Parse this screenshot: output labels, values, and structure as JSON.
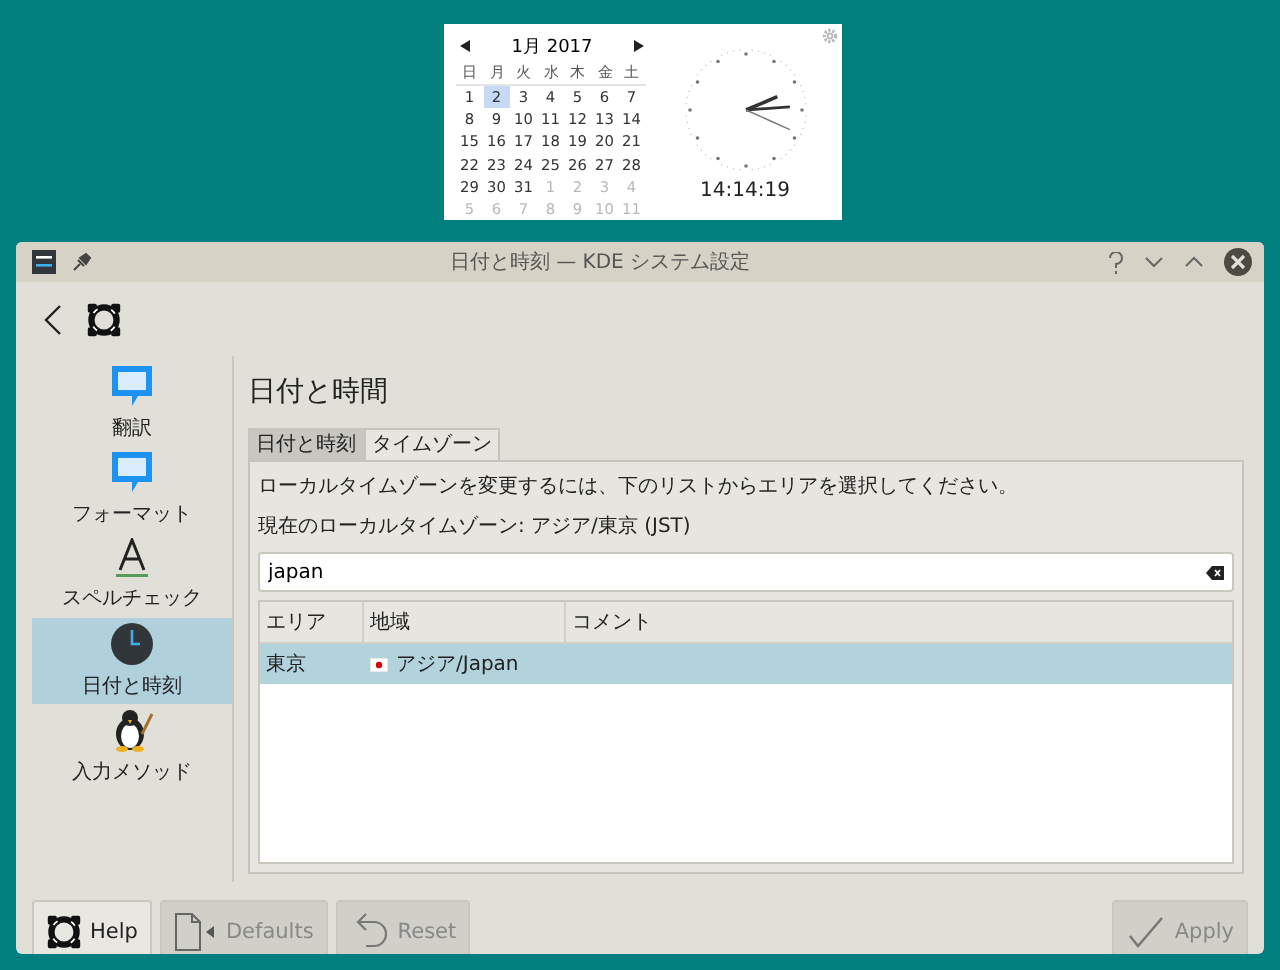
{
  "calendar": {
    "month_label": "1月 2017",
    "weekdays": [
      "日",
      "月",
      "火",
      "水",
      "木",
      "金",
      "土"
    ],
    "weeks": [
      [
        {
          "day": "1",
          "other_month": false,
          "selected": false
        },
        {
          "day": "2",
          "other_month": false,
          "selected": true
        },
        {
          "day": "3",
          "other_month": false,
          "selected": false
        },
        {
          "day": "4",
          "other_month": false,
          "selected": false
        },
        {
          "day": "5",
          "other_month": false,
          "selected": false
        },
        {
          "day": "6",
          "other_month": false,
          "selected": false
        },
        {
          "day": "7",
          "other_month": false,
          "selected": false
        }
      ],
      [
        {
          "day": "8",
          "other_month": false,
          "selected": false
        },
        {
          "day": "9",
          "other_month": false,
          "selected": false
        },
        {
          "day": "10",
          "other_month": false,
          "selected": false
        },
        {
          "day": "11",
          "other_month": false,
          "selected": false
        },
        {
          "day": "12",
          "other_month": false,
          "selected": false
        },
        {
          "day": "13",
          "other_month": false,
          "selected": false
        },
        {
          "day": "14",
          "other_month": false,
          "selected": false
        }
      ],
      [
        {
          "day": "15",
          "other_month": false,
          "selected": false
        },
        {
          "day": "16",
          "other_month": false,
          "selected": false
        },
        {
          "day": "17",
          "other_month": false,
          "selected": false
        },
        {
          "day": "18",
          "other_month": false,
          "selected": false
        },
        {
          "day": "19",
          "other_month": false,
          "selected": false
        },
        {
          "day": "20",
          "other_month": false,
          "selected": false
        },
        {
          "day": "21",
          "other_month": false,
          "selected": false
        }
      ],
      [
        {
          "day": "22",
          "other_month": false,
          "selected": false
        },
        {
          "day": "23",
          "other_month": false,
          "selected": false
        },
        {
          "day": "24",
          "other_month": false,
          "selected": false
        },
        {
          "day": "25",
          "other_month": false,
          "selected": false
        },
        {
          "day": "26",
          "other_month": false,
          "selected": false
        },
        {
          "day": "27",
          "other_month": false,
          "selected": false
        },
        {
          "day": "28",
          "other_month": false,
          "selected": false
        }
      ],
      [
        {
          "day": "29",
          "other_month": false,
          "selected": false
        },
        {
          "day": "30",
          "other_month": false,
          "selected": false
        },
        {
          "day": "31",
          "other_month": false,
          "selected": false
        },
        {
          "day": "1",
          "other_month": true,
          "selected": false
        },
        {
          "day": "2",
          "other_month": true,
          "selected": false
        },
        {
          "day": "3",
          "other_month": true,
          "selected": false
        },
        {
          "day": "4",
          "other_month": true,
          "selected": false
        }
      ],
      [
        {
          "day": "5",
          "other_month": true,
          "selected": false
        },
        {
          "day": "6",
          "other_month": true,
          "selected": false
        },
        {
          "day": "7",
          "other_month": true,
          "selected": false
        },
        {
          "day": "8",
          "other_month": true,
          "selected": false
        },
        {
          "day": "9",
          "other_month": true,
          "selected": false
        },
        {
          "day": "10",
          "other_month": true,
          "selected": false
        },
        {
          "day": "11",
          "other_month": true,
          "selected": false
        }
      ]
    ]
  },
  "clock": {
    "time": "14:14:19"
  },
  "window": {
    "title": "日付と時刻  — KDE システム設定"
  },
  "sidebar": {
    "items": [
      {
        "label": "翻訳",
        "kind": "bubble",
        "selected": false
      },
      {
        "label": "フォーマット",
        "kind": "bubble",
        "selected": false
      },
      {
        "label": "スペルチェック",
        "kind": "letter",
        "selected": false
      },
      {
        "label": "日付と時刻",
        "kind": "clock",
        "selected": true
      },
      {
        "label": "入力メソッド",
        "kind": "penguin",
        "selected": false
      }
    ]
  },
  "page_title": "日付と時間",
  "tabs": [
    {
      "label": "日付と時刻",
      "selected": false
    },
    {
      "label": "タイムゾーン",
      "selected": true
    }
  ],
  "instructions": "ローカルタイムゾーンを変更するには、下のリストからエリアを選択してください。",
  "current_zone": "現在のローカルタイムゾーン: アジア/東京 (JST)",
  "search": {
    "value": "japan"
  },
  "table": {
    "columns": [
      "エリア",
      "地域",
      "コメント"
    ],
    "rows": [
      {
        "area": "東京",
        "region": "アジア/Japan",
        "selected": true
      }
    ]
  },
  "buttons": [
    {
      "label": "Help",
      "kind": "help",
      "disabled": false
    },
    {
      "label": "Defaults",
      "kind": "defaults",
      "disabled": true
    },
    {
      "label": "Reset",
      "kind": "reset",
      "disabled": true
    },
    {
      "label": "Apply",
      "kind": "apply",
      "disabled": true
    }
  ]
}
